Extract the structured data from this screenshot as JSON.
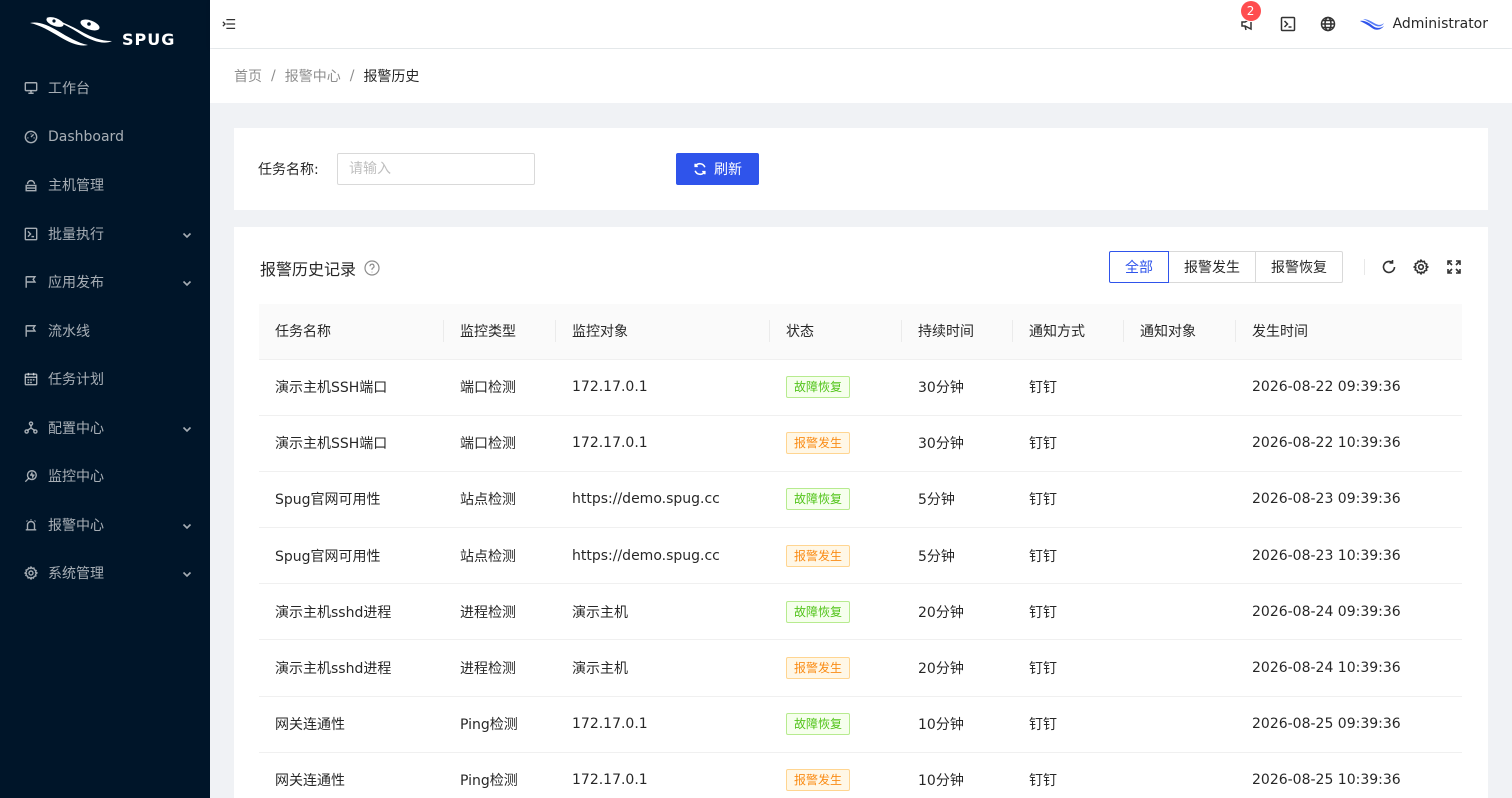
{
  "sidebar": {
    "logo_text": "SPUG",
    "items": [
      {
        "label": "工作台",
        "icon": "desktop-icon",
        "has_submenu": false
      },
      {
        "label": "Dashboard",
        "icon": "dashboard-icon",
        "has_submenu": false
      },
      {
        "label": "主机管理",
        "icon": "cloud-server-icon",
        "has_submenu": false
      },
      {
        "label": "批量执行",
        "icon": "code-icon",
        "has_submenu": true
      },
      {
        "label": "应用发布",
        "icon": "flag-icon",
        "has_submenu": true
      },
      {
        "label": "流水线",
        "icon": "flag-icon",
        "has_submenu": false
      },
      {
        "label": "任务计划",
        "icon": "schedule-icon",
        "has_submenu": false
      },
      {
        "label": "配置中心",
        "icon": "deployment-icon",
        "has_submenu": true
      },
      {
        "label": "监控中心",
        "icon": "monitor-icon",
        "has_submenu": false
      },
      {
        "label": "报警中心",
        "icon": "alert-icon",
        "has_submenu": true
      },
      {
        "label": "系统管理",
        "icon": "setting-icon",
        "has_submenu": true
      }
    ]
  },
  "header": {
    "notification_count": "2",
    "username": "Administrator"
  },
  "breadcrumb": [
    "首页",
    "报警中心",
    "报警历史"
  ],
  "search": {
    "label": "任务名称:",
    "placeholder": "请输入",
    "value": "",
    "refresh_label": "刷新"
  },
  "table": {
    "title": "报警历史记录",
    "filters": [
      "全部",
      "报警发生",
      "报警恢复"
    ],
    "active_filter": "全部",
    "columns": [
      "任务名称",
      "监控类型",
      "监控对象",
      "状态",
      "持续时间",
      "通知方式",
      "通知对象",
      "发生时间"
    ],
    "rows": [
      {
        "name": "演示主机SSH端口",
        "type": "端口检测",
        "target": "172.17.0.1",
        "status": "故障恢复",
        "status_color": "green",
        "duration": "30分钟",
        "notify_mode": "钉钉",
        "notify_target": "",
        "time": "2026-08-22 09:39:36"
      },
      {
        "name": "演示主机SSH端口",
        "type": "端口检测",
        "target": "172.17.0.1",
        "status": "报警发生",
        "status_color": "orange",
        "duration": "30分钟",
        "notify_mode": "钉钉",
        "notify_target": "",
        "time": "2026-08-22 10:39:36"
      },
      {
        "name": "Spug官网可用性",
        "type": "站点检测",
        "target": "https://demo.spug.cc",
        "status": "故障恢复",
        "status_color": "green",
        "duration": "5分钟",
        "notify_mode": "钉钉",
        "notify_target": "",
        "time": "2026-08-23 09:39:36"
      },
      {
        "name": "Spug官网可用性",
        "type": "站点检测",
        "target": "https://demo.spug.cc",
        "status": "报警发生",
        "status_color": "orange",
        "duration": "5分钟",
        "notify_mode": "钉钉",
        "notify_target": "",
        "time": "2026-08-23 10:39:36"
      },
      {
        "name": "演示主机sshd进程",
        "type": "进程检测",
        "target": "演示主机",
        "status": "故障恢复",
        "status_color": "green",
        "duration": "20分钟",
        "notify_mode": "钉钉",
        "notify_target": "",
        "time": "2026-08-24 09:39:36"
      },
      {
        "name": "演示主机sshd进程",
        "type": "进程检测",
        "target": "演示主机",
        "status": "报警发生",
        "status_color": "orange",
        "duration": "20分钟",
        "notify_mode": "钉钉",
        "notify_target": "",
        "time": "2026-08-24 10:39:36"
      },
      {
        "name": "网关连通性",
        "type": "Ping检测",
        "target": "172.17.0.1",
        "status": "故障恢复",
        "status_color": "green",
        "duration": "10分钟",
        "notify_mode": "钉钉",
        "notify_target": "",
        "time": "2026-08-25 09:39:36"
      },
      {
        "name": "网关连通性",
        "type": "Ping检测",
        "target": "172.17.0.1",
        "status": "报警发生",
        "status_color": "orange",
        "duration": "10分钟",
        "notify_mode": "钉钉",
        "notify_target": "",
        "time": "2026-08-25 10:39:36"
      }
    ]
  },
  "colors": {
    "sidebar_bg": "#001529",
    "primary": "#2f54eb",
    "badge": "#ff4d4f",
    "tag_green": "#52c41a",
    "tag_orange": "#fa8c16"
  }
}
